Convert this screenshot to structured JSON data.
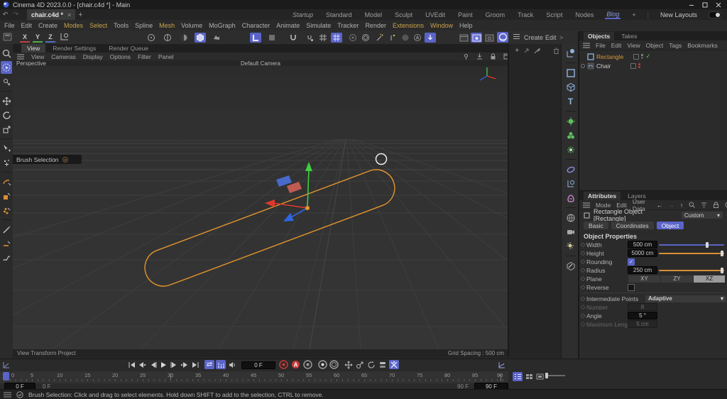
{
  "window": {
    "title": "Cinema 4D 2023.0.0 - [chair.c4d *] - Main"
  },
  "document_tabs": {
    "active_tab": "chair.c4d *",
    "close": "×",
    "add_tab": "+"
  },
  "layout_tabs": {
    "items": [
      "Startup",
      "Standard",
      "Model",
      "Sculpt",
      "UVEdit",
      "Paint",
      "Groom",
      "Track",
      "Script",
      "Nodes",
      "Blog"
    ],
    "active": "Blog",
    "add": "+",
    "new_layouts": "New Layouts"
  },
  "menu_bar": {
    "items": [
      "File",
      "Edit",
      "Create",
      "Modes",
      "Select",
      "Tools",
      "Spline",
      "Mesh",
      "Volume",
      "MoGraph",
      "Character",
      "Animate",
      "Simulate",
      "Tracker",
      "Render",
      "Extensions",
      "Window",
      "Help"
    ]
  },
  "toolbar": {
    "axis_x": "X",
    "axis_y": "Y",
    "axis_z": "Z"
  },
  "dock_menu": {
    "create": "Create",
    "edit": "Edit",
    "more": ">"
  },
  "viewport": {
    "tabs": [
      "View",
      "Render Settings",
      "Render Queue"
    ],
    "active_tab": "View",
    "menu": [
      "View",
      "Cameras",
      "Display",
      "Options",
      "Filter",
      "Panel"
    ],
    "view_label": "Perspective",
    "camera_label": "Default Camera",
    "hud_tool": "Brush Selection",
    "footer_left": "View Transform Project",
    "footer_right": "Grid Spacing : 500 cm"
  },
  "objects_panel": {
    "tabs": [
      "Objects",
      "Takes"
    ],
    "active_tab": "Objects",
    "menu": [
      "File",
      "Edit",
      "View",
      "Object",
      "Tags",
      "Bookmarks"
    ],
    "items": [
      {
        "name": "Rectangle"
      },
      {
        "name": "Chair"
      }
    ],
    "rectangle_check": "✓"
  },
  "attributes_panel": {
    "tabs": [
      "Attributes",
      "Layers"
    ],
    "active_tab": "Attributes",
    "menu": [
      "Mode",
      "Edit",
      "User Data"
    ],
    "object_title": "Rectangle Object [Rectangle]",
    "preset": "Custom",
    "tab_buttons": [
      "Basic",
      "Coordinates",
      "Object"
    ],
    "active_tab_button": "Object",
    "section_title": "Object Properties",
    "rows": {
      "width": {
        "label": "Width",
        "value": "500 cm"
      },
      "height": {
        "label": "Height",
        "value": "5000 cm"
      },
      "rounding": {
        "label": "Rounding",
        "checked": true
      },
      "radius": {
        "label": "Radius",
        "value": "250 cm"
      },
      "plane": {
        "label": "Plane",
        "options": [
          "XY",
          "ZY",
          "XZ"
        ],
        "active": "XZ"
      },
      "reverse": {
        "label": "Reverse",
        "checked": false
      },
      "intermediate_points": {
        "label": "Intermediate Points",
        "value": "Adaptive"
      },
      "number": {
        "label": "Number",
        "value": "8"
      },
      "angle": {
        "label": "Angle",
        "value": "5 °"
      },
      "maximum_length": {
        "label": "Maximum Length",
        "value": "5 cm"
      }
    }
  },
  "timeline": {
    "current_frame": "0 F",
    "ticks": [
      "0",
      "5",
      "10",
      "15",
      "20",
      "25",
      "30",
      "35",
      "40",
      "45",
      "50",
      "55",
      "60",
      "65",
      "70",
      "75",
      "80",
      "85",
      "90"
    ],
    "range_start_value": "0 F",
    "range_start_label": "0 F",
    "range_end_label": "90 F",
    "range_end_value": "90 F"
  },
  "status_bar": {
    "message": "Brush Selection: Click and drag to select elements. Hold down SHIFT to add to the selection, CTRL to remove."
  },
  "colors": {
    "accent_blue": "#5a64c8",
    "accent_yellow": "#c8a24b",
    "spline_orange": "#e2952f",
    "record_red": "#c83a36"
  }
}
